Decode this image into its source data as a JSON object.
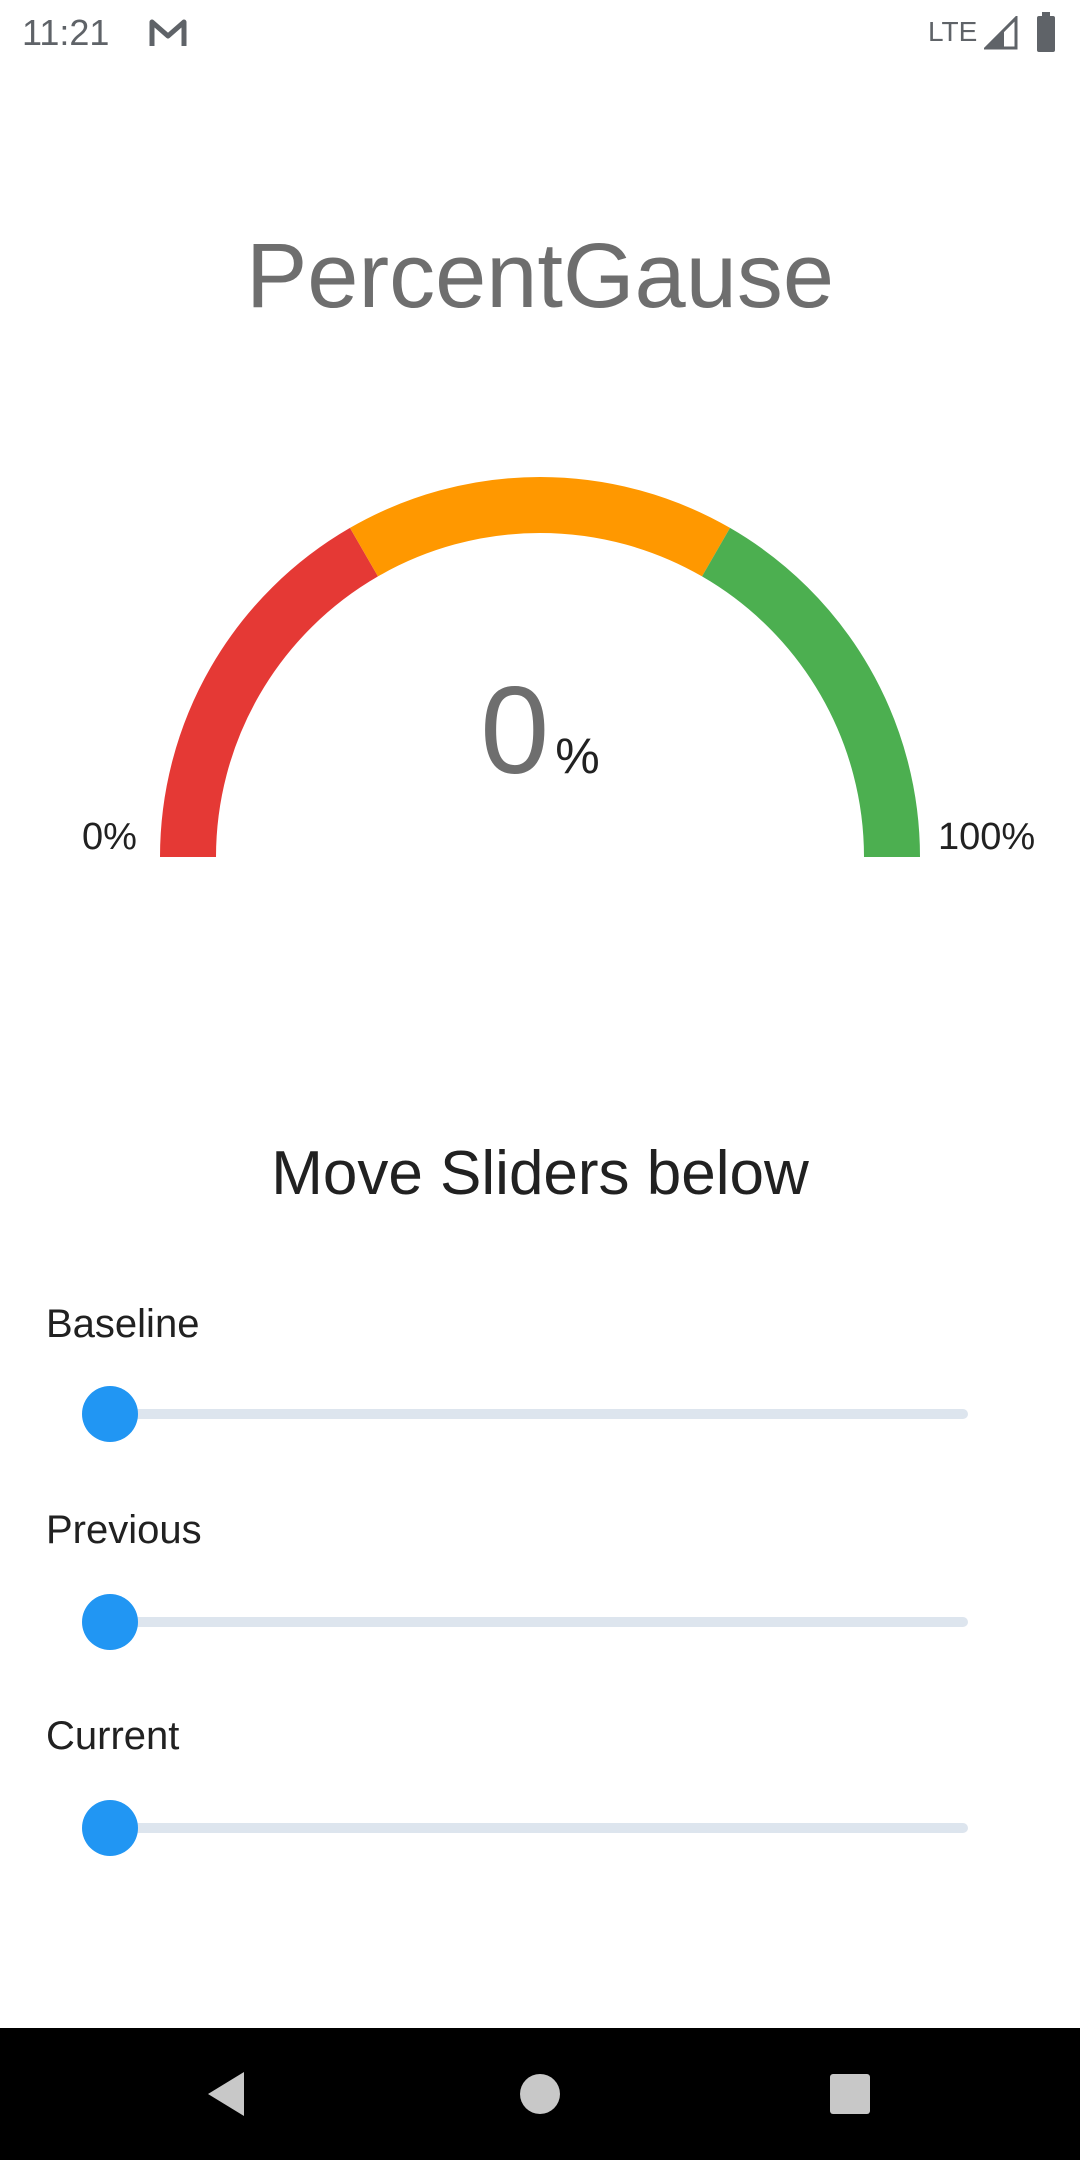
{
  "status_bar": {
    "time": "11:21",
    "network": "LTE",
    "icons": [
      "gmail-icon",
      "signal-icon",
      "battery-icon"
    ]
  },
  "app": {
    "title": "PercentGause"
  },
  "gauge": {
    "value": "0",
    "unit": "%",
    "min_label": "0%",
    "max_label": "100%",
    "segments": [
      {
        "color": "#e53935",
        "from": 0.0,
        "to": 0.3333
      },
      {
        "color": "#ff9800",
        "from": 0.3333,
        "to": 0.6667
      },
      {
        "color": "#4caf50",
        "from": 0.6667,
        "to": 1.0
      }
    ]
  },
  "instruction": "Move Sliders below",
  "sliders": [
    {
      "label": "Baseline",
      "value": 0
    },
    {
      "label": "Previous",
      "value": 0
    },
    {
      "label": "Current",
      "value": 0
    }
  ],
  "colors": {
    "accent": "#2196f3",
    "title_gray": "#6e6e6e",
    "nav_bar": "#000000"
  },
  "nav_bar": {
    "icons": [
      "back-icon",
      "home-icon",
      "recents-icon"
    ]
  }
}
